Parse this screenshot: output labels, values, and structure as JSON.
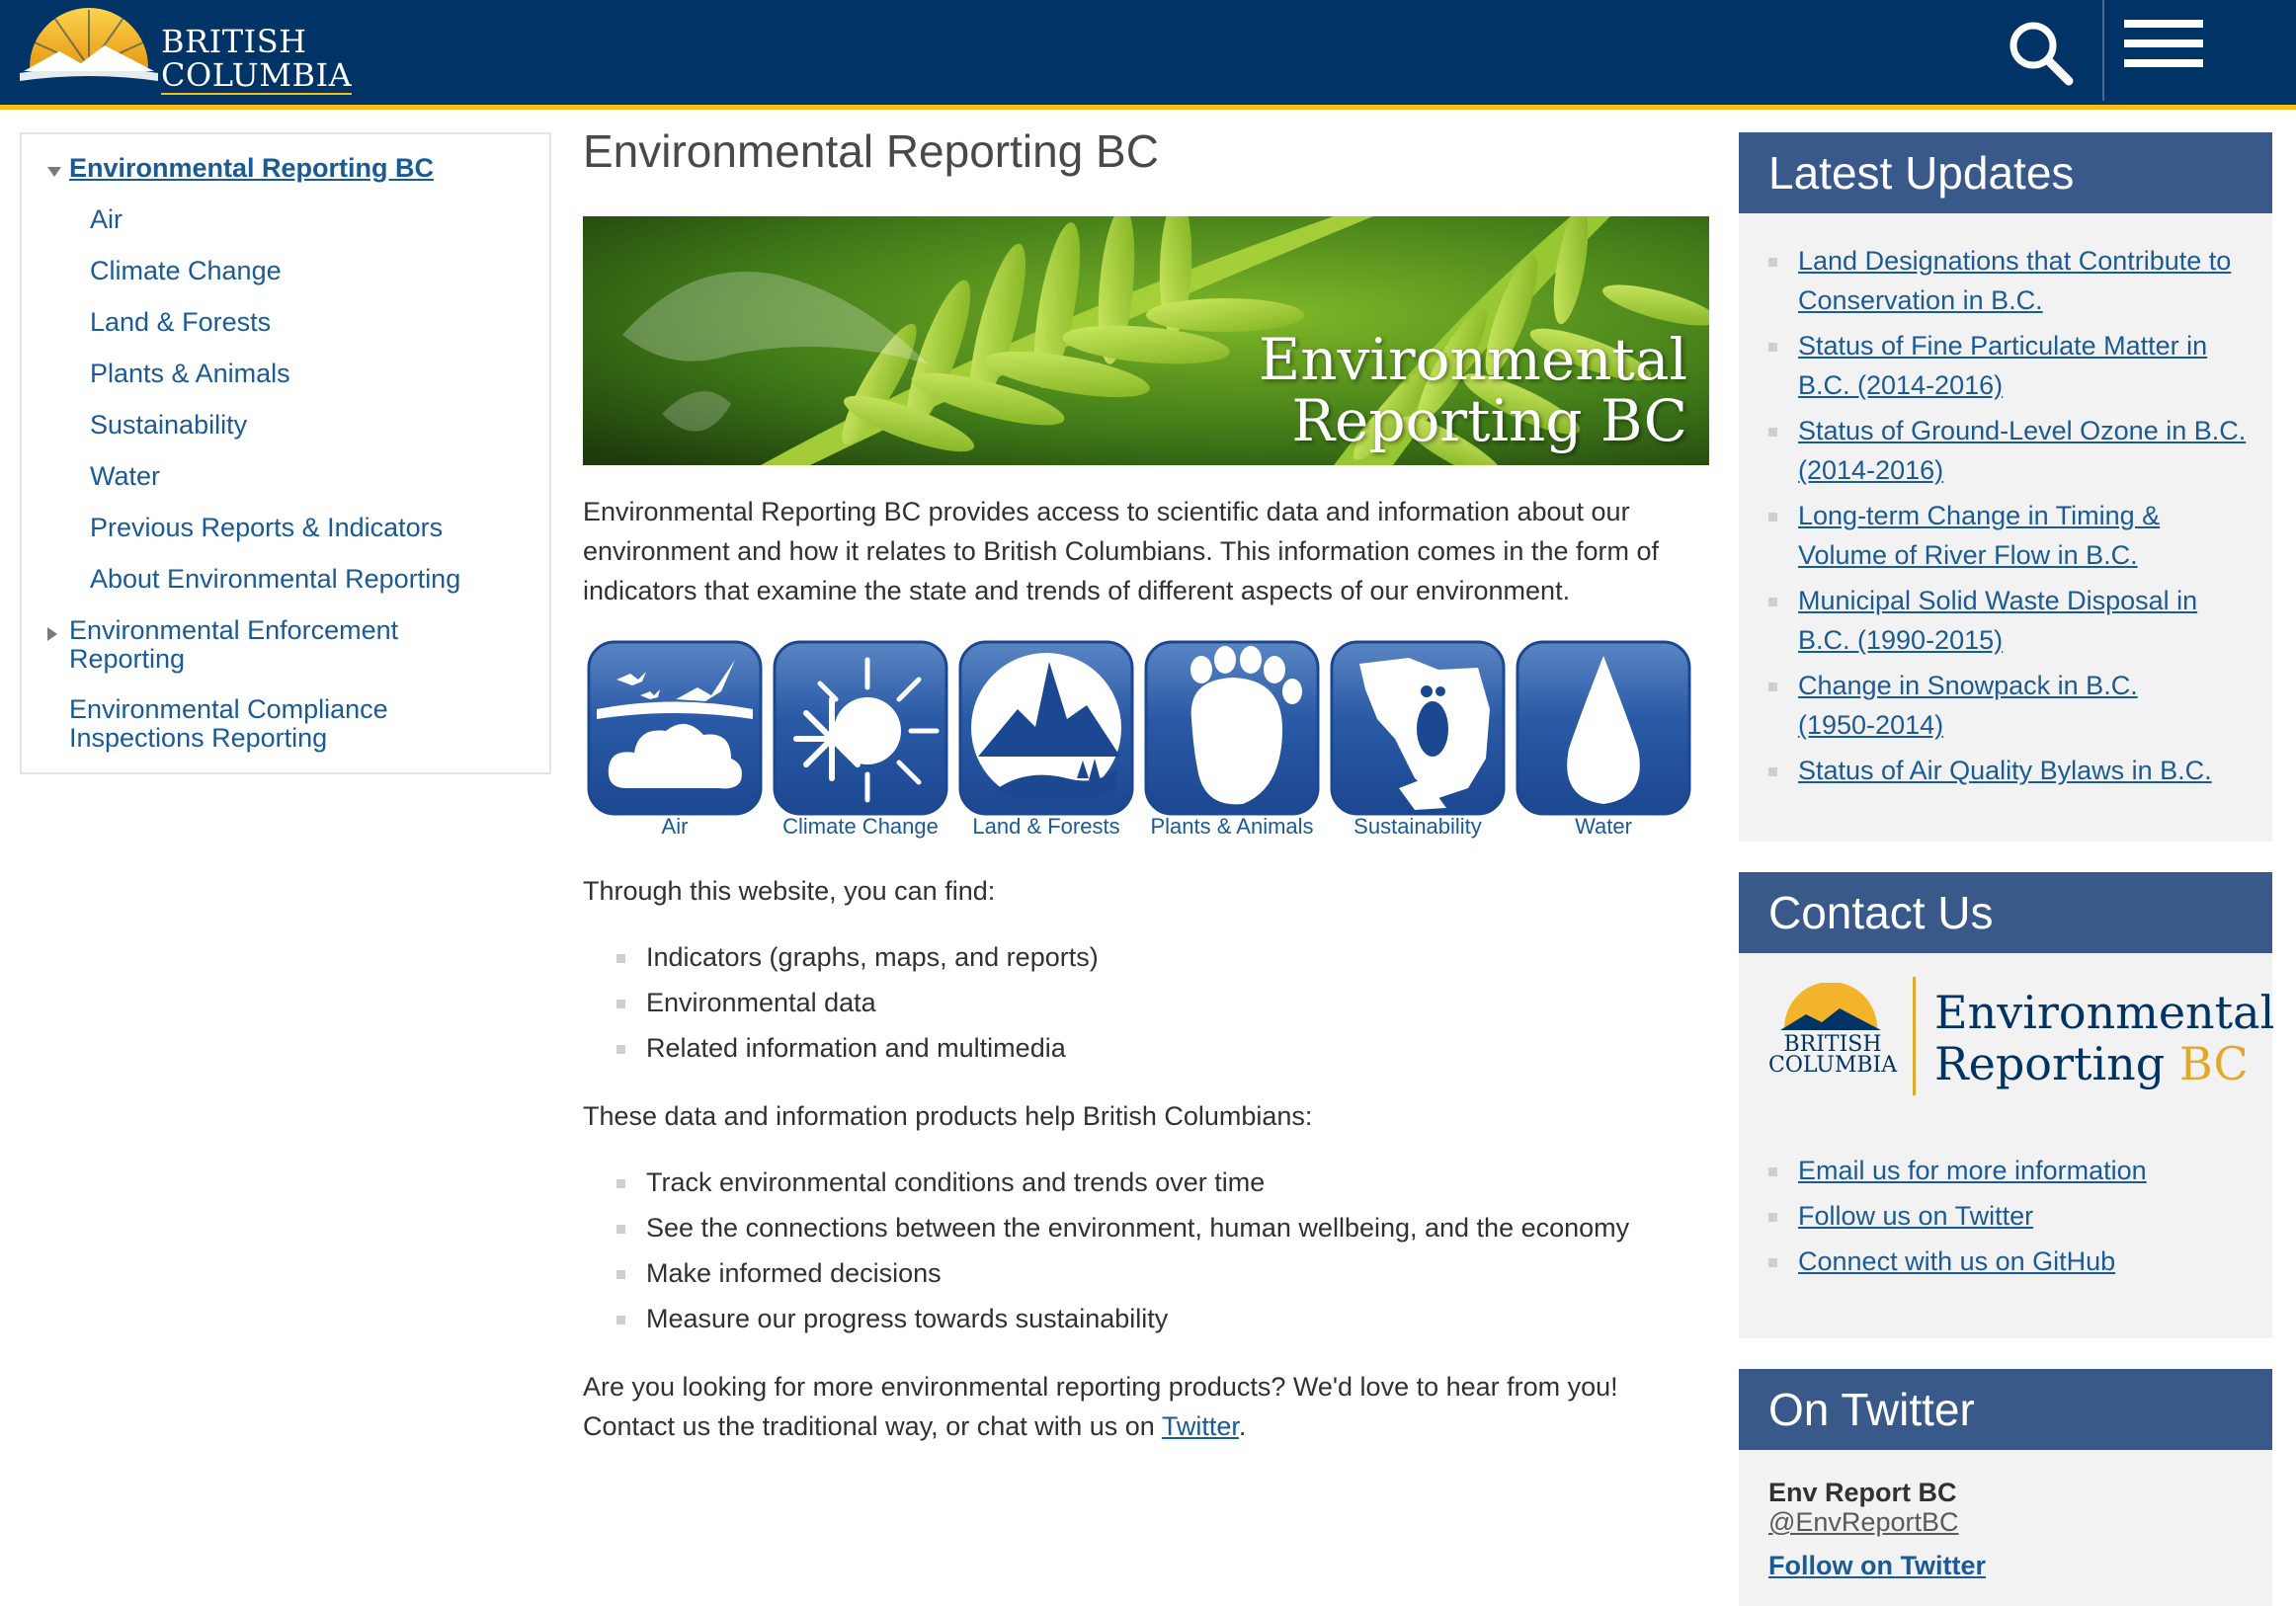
{
  "header": {
    "logo_line1": "BRITISH",
    "logo_line2": "COLUMBIA",
    "search_icon": "search-icon",
    "menu_icon": "hamburger-menu-icon",
    "colors": {
      "bar": "#003366",
      "accent": "#fcba19"
    }
  },
  "leftnav": {
    "items": [
      {
        "label": "Environmental Reporting BC"
      },
      {
        "label": "Air"
      },
      {
        "label": "Climate Change"
      },
      {
        "label": "Land & Forests"
      },
      {
        "label": "Plants & Animals"
      },
      {
        "label": "Sustainability"
      },
      {
        "label": "Water"
      },
      {
        "label": "Previous Reports & Indicators"
      },
      {
        "label": "About Environmental Reporting"
      },
      {
        "label_line1": "Environmental Enforcement",
        "label_line2": "Reporting"
      },
      {
        "label_line1": "Environmental Compliance",
        "label_line2": "Inspections Reporting"
      }
    ]
  },
  "main": {
    "title": "Environmental Reporting BC",
    "banner": {
      "line1": "Environmental",
      "line2": "Reporting BC"
    },
    "intro_line1": "Environmental Reporting BC provides access to scientific data and information about our",
    "intro_line2": "environment and how it relates to British Columbians. This information comes in the form of",
    "intro_line3": "indicators that examine the state and trends of different aspects of our environment.",
    "topics": [
      {
        "label": "Air",
        "icon": "air-cloud-birds-icon"
      },
      {
        "label": "Climate Change",
        "icon": "climate-snowflake-sun-icon"
      },
      {
        "label": "Land & Forests",
        "icon": "land-mountain-trees-icon"
      },
      {
        "label": "Plants & Animals",
        "icon": "bear-paw-icon"
      },
      {
        "label": "Sustainability",
        "icon": "bc-map-footprint-icon"
      },
      {
        "label": "Water",
        "icon": "water-drop-icon"
      }
    ],
    "find_intro": "Through this website, you can find:",
    "find_items": [
      "Indicators (graphs, maps, and reports)",
      "Environmental data",
      "Related information and multimedia"
    ],
    "help_intro": "These data and information products help British Columbians:",
    "help_items": [
      "Track environmental conditions and trends over time",
      "See the connections between the environment, human wellbeing, and the economy",
      "Make informed decisions",
      "Measure our progress towards sustainability"
    ],
    "closing_line1": "Are you looking for more environmental reporting products? We'd love to hear from you!",
    "closing_line2_pre": "Contact us the traditional way, or chat with us on ",
    "closing_link": "Twitter",
    "closing_line2_post": "."
  },
  "latest": {
    "title": "Latest Updates",
    "items": [
      {
        "l1": "Land Designations that Contribute to",
        "l2": "Conservation in B.C."
      },
      {
        "l1": "Status of Fine Particulate Matter in",
        "l2": "B.C. (2014-2016)"
      },
      {
        "l1": "Status of Ground-Level Ozone in B.C.",
        "l2": "(2014-2016)"
      },
      {
        "l1": "Long-term Change in Timing &",
        "l2": "Volume of River Flow in B.C."
      },
      {
        "l1": "Municipal Solid Waste Disposal in",
        "l2": "B.C. (1990-2015)"
      },
      {
        "l1": "Change in Snowpack in B.C.",
        "l2": "(1950-2014)"
      },
      {
        "l1": "Status of Air Quality Bylaws in B.C.",
        "l2": ""
      }
    ]
  },
  "contact": {
    "title": "Contact Us",
    "logo_bc_line1": "BRITISH",
    "logo_bc_line2": "COLUMBIA",
    "logo_er_line1": "Environmental",
    "logo_er_line2a": "Reporting",
    "logo_er_line2b": "BC",
    "links": [
      "Email us for more information",
      "Follow us on Twitter",
      "Connect with us on GitHub"
    ]
  },
  "twitter": {
    "title": "On Twitter",
    "name": "Env Report BC",
    "handle": "@EnvReportBC",
    "follow": "Follow on Twitter"
  }
}
